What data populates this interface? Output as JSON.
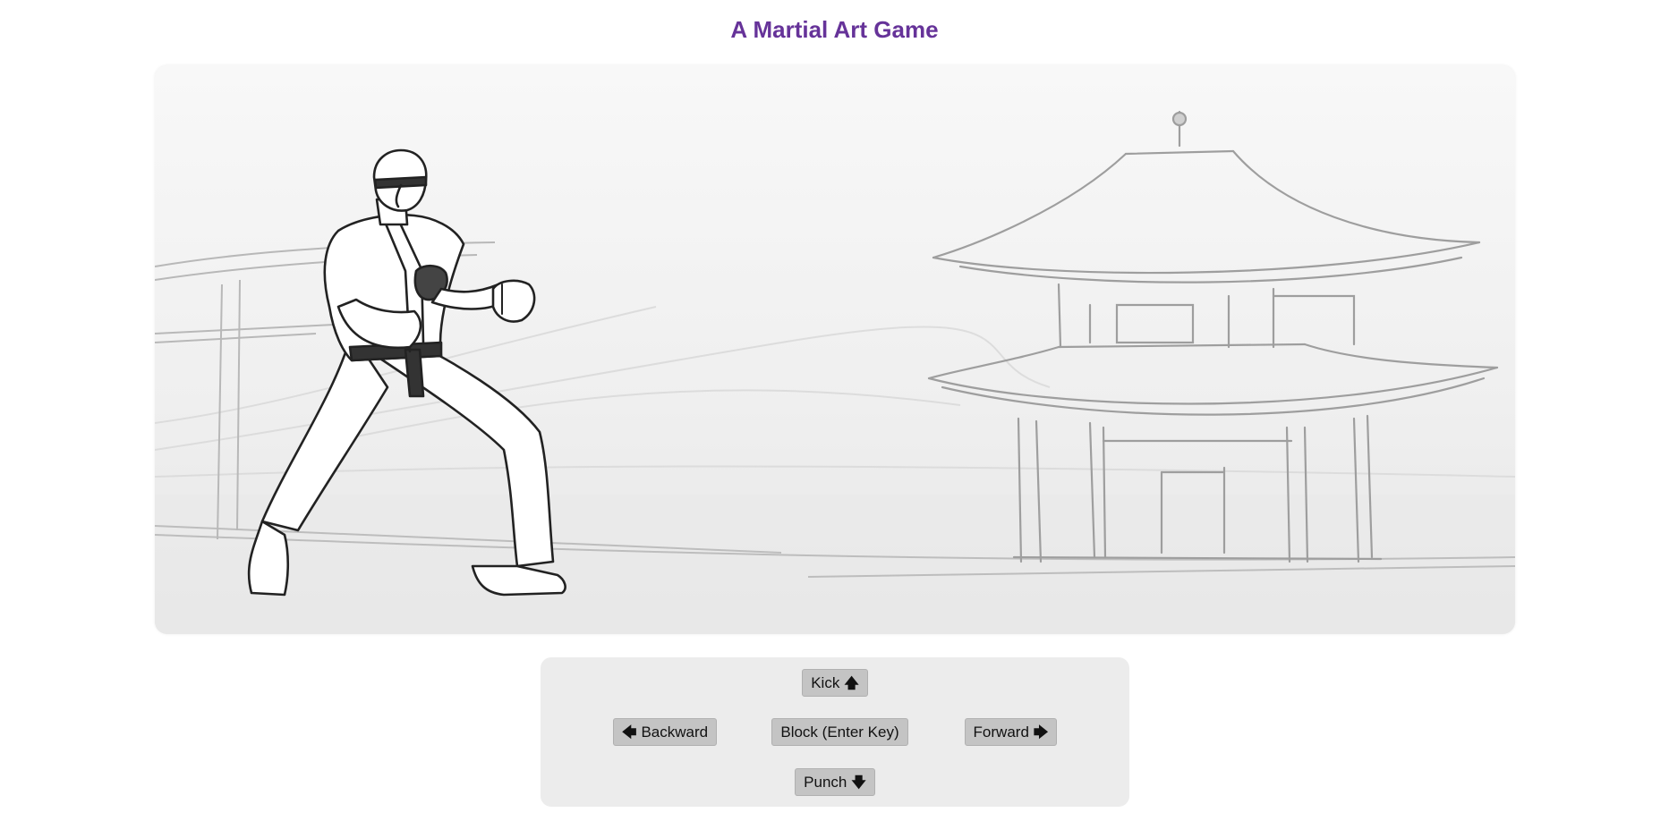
{
  "page": {
    "title": "A Martial Art Game"
  },
  "scene": {
    "player_icon": "karate-fighter",
    "background_icon": "pagoda-temple"
  },
  "controls": {
    "kick_label": "Kick",
    "kick_icon": "arrow-up-icon",
    "backward_label": "Backward",
    "backward_icon": "arrow-left-icon",
    "block_label": "Block (Enter Key)",
    "forward_label": "Forward",
    "forward_icon": "arrow-right-icon",
    "punch_label": "Punch",
    "punch_icon": "arrow-down-icon"
  },
  "colors": {
    "title": "#663399",
    "button_bg": "#c4c4c4",
    "panel_bg": "#ececec"
  }
}
